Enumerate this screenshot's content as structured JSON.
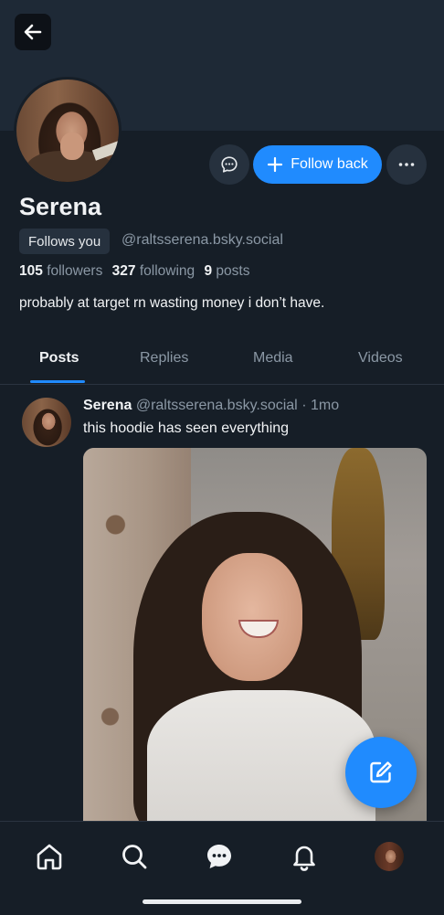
{
  "profile": {
    "name": "Serena",
    "follows_you": "Follows you",
    "handle": "@raltsserena.bsky.social",
    "followers_count": "105",
    "followers_label": "followers",
    "following_count": "327",
    "following_label": "following",
    "posts_count": "9",
    "posts_label": "posts",
    "bio": "probably at target rn wasting money i don’t have."
  },
  "actions": {
    "follow_back": "Follow back"
  },
  "tabs": [
    {
      "label": "Posts",
      "active": true
    },
    {
      "label": "Replies",
      "active": false
    },
    {
      "label": "Media",
      "active": false
    },
    {
      "label": "Videos",
      "active": false
    }
  ],
  "post": {
    "author": "Serena",
    "handle": "@raltsserena.bsky.social",
    "separator": "·",
    "time": "1mo",
    "text": "this hoodie has seen everything"
  },
  "icons": {
    "back": "arrow-left-icon",
    "message": "chat-bubble-icon",
    "plus": "plus-icon",
    "more": "ellipsis-icon",
    "compose": "compose-icon",
    "nav": [
      "home-icon",
      "search-icon",
      "chat-icon",
      "bell-icon",
      "avatar"
    ]
  },
  "colors": {
    "accent": "#208bfe",
    "background": "#161e27",
    "banner": "#1e2936",
    "muted_text": "#8b98a5"
  }
}
